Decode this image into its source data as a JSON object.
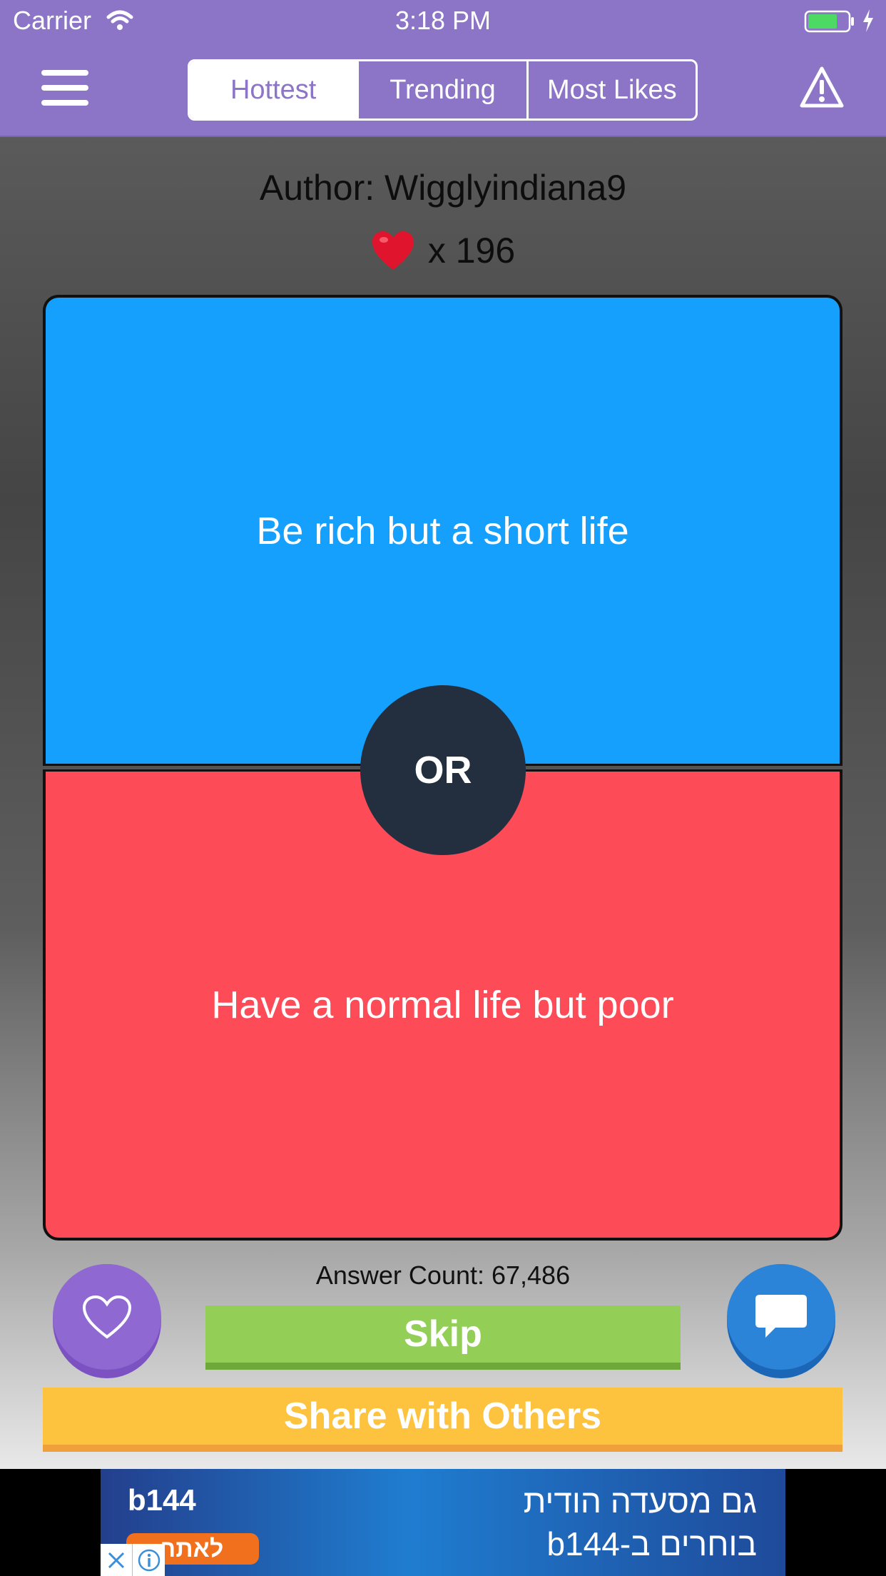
{
  "status_bar": {
    "carrier": "Carrier",
    "time": "3:18 PM"
  },
  "nav": {
    "tabs": [
      {
        "label": "Hottest",
        "selected": true
      },
      {
        "label": "Trending",
        "selected": false
      },
      {
        "label": "Most Likes",
        "selected": false
      }
    ],
    "menu_icon": "hamburger-icon",
    "report_icon": "warning-triangle-icon"
  },
  "question": {
    "author_label": "Author: Wigglyindiana9",
    "likes_text": "x 196",
    "option_a": "Be rich but a short life",
    "option_b": "Have a normal life but poor",
    "divider_text": "OR",
    "answer_count": "Answer Count: 67,486"
  },
  "actions": {
    "skip_label": "Skip",
    "share_label": "Share with Others",
    "like_icon": "heart-outline-icon",
    "comment_icon": "speech-bubble-icon"
  },
  "ad": {
    "brand": "b144",
    "cta": "לאתר",
    "line1": "גם מסעדה הודית",
    "line2": "בוחרים ב-b144"
  },
  "colors": {
    "header": "#8c74c7",
    "option_a": "#14a0fc",
    "option_b": "#fd4b57",
    "or_badge": "#232f3e",
    "skip": "#93cf56",
    "share": "#fdc33f",
    "like_button": "#9068d1",
    "comment_button": "#2c84d8"
  }
}
